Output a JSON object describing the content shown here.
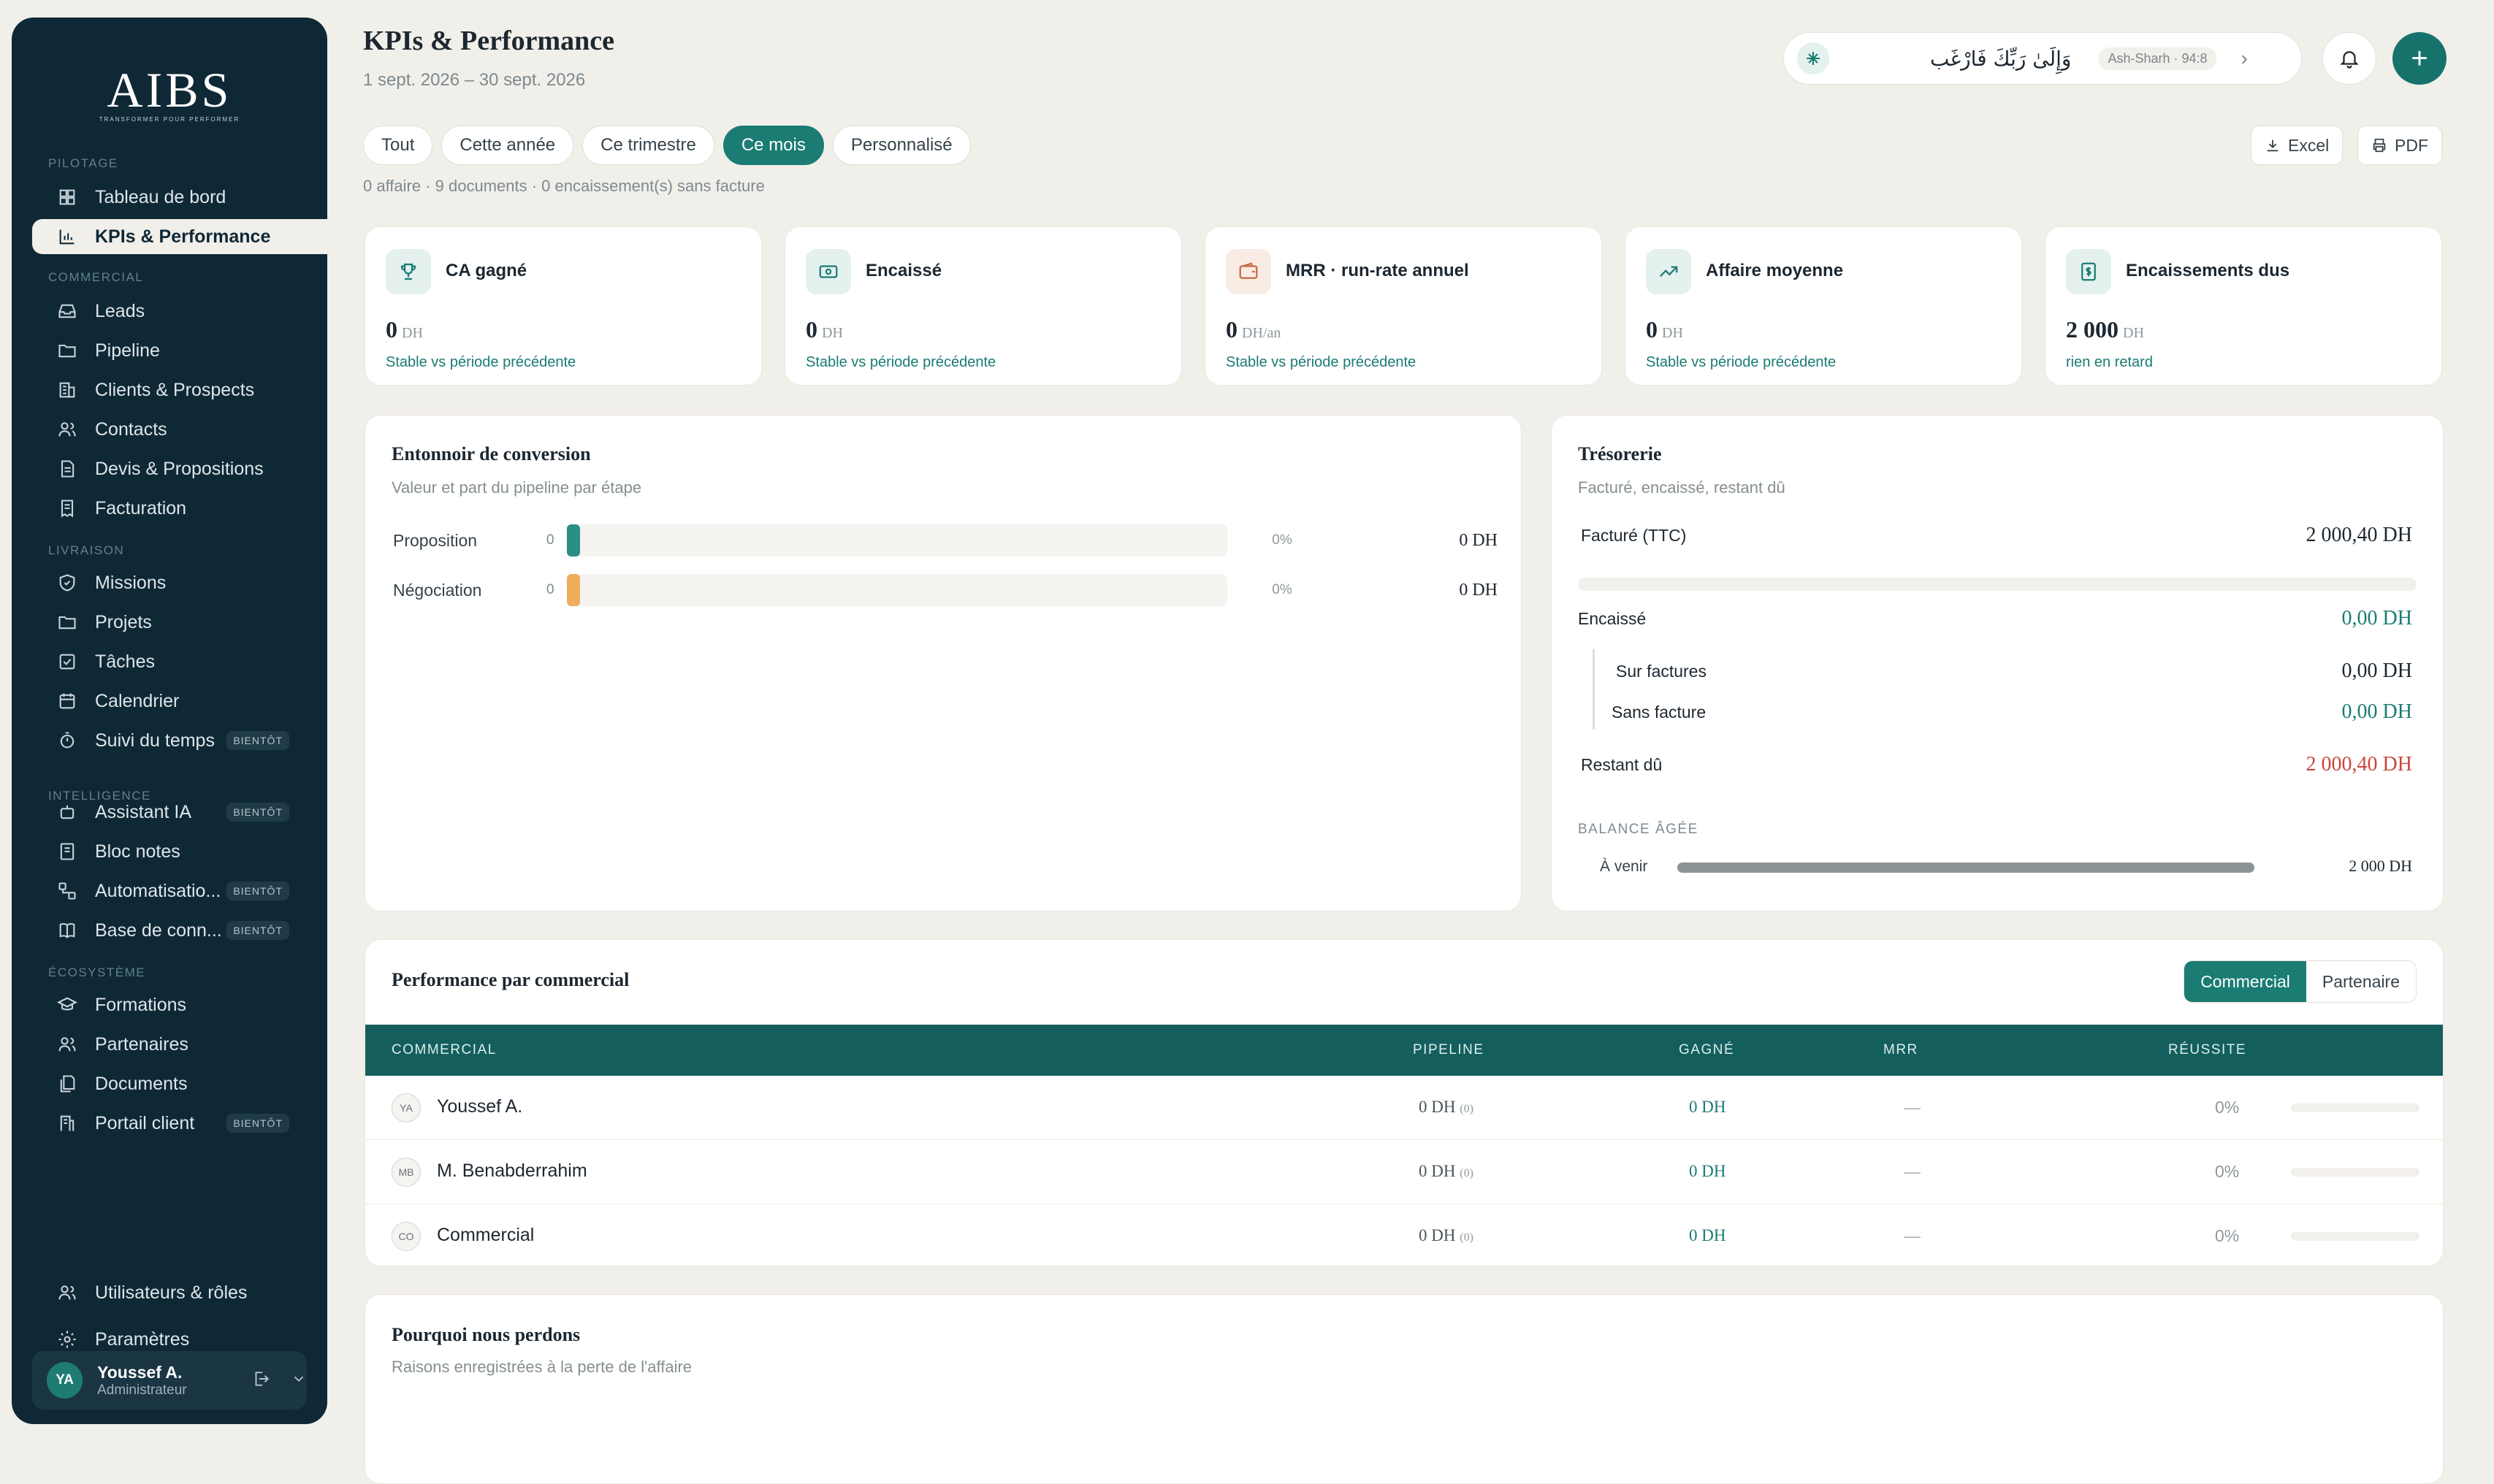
{
  "brand": {
    "name": "AIBS",
    "tagline": "TRANSFORMER POUR PERFORMER"
  },
  "sidebar": {
    "sections": [
      {
        "label": "PILOTAGE"
      },
      {
        "label": "COMMERCIAL"
      },
      {
        "label": "LIVRAISON"
      },
      {
        "label": "INTELLIGENCE"
      },
      {
        "label": "ÉCOSYSTÈME"
      }
    ],
    "items": [
      {
        "label": "Tableau de bord",
        "icon": "grid-icon"
      },
      {
        "label": "KPIs & Performance",
        "icon": "bar-chart-icon",
        "active": true
      },
      {
        "label": "Leads",
        "icon": "inbox-icon"
      },
      {
        "label": "Pipeline",
        "icon": "folder-icon"
      },
      {
        "label": "Clients & Prospects",
        "icon": "building-icon"
      },
      {
        "label": "Contacts",
        "icon": "users-icon"
      },
      {
        "label": "Devis & Propositions",
        "icon": "file-icon"
      },
      {
        "label": "Facturation",
        "icon": "receipt-icon"
      },
      {
        "label": "Missions",
        "icon": "badge-icon"
      },
      {
        "label": "Projets",
        "icon": "folder-icon"
      },
      {
        "label": "Tâches",
        "icon": "checkbox-icon"
      },
      {
        "label": "Calendrier",
        "icon": "calendar-icon"
      },
      {
        "label": "Suivi du temps",
        "icon": "timer-icon",
        "badge": "BIENTÔT"
      },
      {
        "label": "Assistant IA",
        "icon": "bot-icon",
        "badge": "BIENTÔT"
      },
      {
        "label": "Bloc notes",
        "icon": "notebook-icon"
      },
      {
        "label": "Automatisatio...",
        "icon": "workflow-icon",
        "badge": "BIENTÔT"
      },
      {
        "label": "Base de conn...",
        "icon": "book-icon",
        "badge": "BIENTÔT"
      },
      {
        "label": "Formations",
        "icon": "graduation-icon"
      },
      {
        "label": "Partenaires",
        "icon": "users-icon"
      },
      {
        "label": "Documents",
        "icon": "documents-icon"
      },
      {
        "label": "Portail client",
        "icon": "portal-icon",
        "badge": "BIENTÔT"
      }
    ],
    "bottom": [
      {
        "label": "Utilisateurs & rôles",
        "icon": "users-icon"
      },
      {
        "label": "Paramètres",
        "icon": "gear-icon"
      }
    ],
    "user": {
      "initials": "YA",
      "name": "Youssef A.",
      "role": "Administrateur"
    }
  },
  "header": {
    "title": "KPIs & Performance",
    "date_range": "1 sept. 2026 – 30 sept. 2026",
    "verse": {
      "text": "وَإِلَىٰ رَبِّكَ فَارْغَب",
      "ref": "Ash-Sharh · 94:8"
    }
  },
  "filters": [
    "Tout",
    "Cette année",
    "Ce trimestre",
    "Ce mois",
    "Personnalisé"
  ],
  "active_filter": "Ce mois",
  "export": {
    "excel": "Excel",
    "pdf": "PDF"
  },
  "meta": "0 affaire · 9 documents · 0 encaissement(s) sans facture",
  "kpis": [
    {
      "title": "CA gagné",
      "value": "0",
      "unit": "DH",
      "sub": "Stable vs période précédente",
      "icon": "trophy-icon",
      "bg": "#e4f1ee",
      "fg": "#1a7c73"
    },
    {
      "title": "Encaissé",
      "value": "0",
      "unit": "DH",
      "sub": "Stable vs période précédente",
      "icon": "cash-icon",
      "bg": "#e4f1ee",
      "fg": "#1a7c73"
    },
    {
      "title": "MRR · run-rate annuel",
      "value": "0",
      "unit": "DH/an",
      "sub": "Stable vs période précédente",
      "icon": "wallet-icon",
      "bg": "#f8ece4",
      "fg": "#c66a45"
    },
    {
      "title": "Affaire moyenne",
      "value": "0",
      "unit": "DH",
      "sub": "Stable vs période précédente",
      "icon": "trend-up-icon",
      "bg": "#e4f1ee",
      "fg": "#1a7c73"
    },
    {
      "title": "Encaissements dus",
      "value": "2 000",
      "unit": "DH",
      "sub": "rien en retard",
      "icon": "dollar-doc-icon",
      "bg": "#e4f1ee",
      "fg": "#1a7c73"
    }
  ],
  "funnel": {
    "title": "Entonnoir de conversion",
    "desc": "Valeur et part du pipeline par étape",
    "rows": [
      {
        "stage": "Proposition",
        "count": "0",
        "pct": "0%",
        "value": "0 DH",
        "color": "#2a8f86"
      },
      {
        "stage": "Négociation",
        "count": "0",
        "pct": "0%",
        "value": "0 DH",
        "color": "#f0ad5c"
      }
    ]
  },
  "treasury": {
    "title": "Trésorerie",
    "desc": "Facturé, encaissé, restant dû",
    "invoiced_label": "Facturé (TTC)",
    "invoiced": "2 000,40 DH",
    "collected_label": "Encaissé",
    "collected": "0,00 DH",
    "on_invoices_label": "Sur factures",
    "on_invoices": "0,00 DH",
    "without_invoice_label": "Sans facture",
    "without_invoice": "0,00 DH",
    "due_label": "Restant dû",
    "due": "2 000,40 DH",
    "aging_label": "BALANCE ÂGÉE",
    "aging_row_label": "À venir",
    "aging_row_value": "2 000 DH"
  },
  "performance": {
    "title": "Performance par commercial",
    "toggle": [
      "Commercial",
      "Partenaire"
    ],
    "columns": [
      "COMMERCIAL",
      "PIPELINE",
      "GAGNÉ",
      "MRR",
      "RÉUSSITE"
    ],
    "rows": [
      {
        "initials": "YA",
        "name": "Youssef A.",
        "pipeline": "0 DH",
        "count": "(0)",
        "won": "0 DH",
        "mrr": "—",
        "rate": "0%"
      },
      {
        "initials": "MB",
        "name": "M. Benabderrahim",
        "pipeline": "0 DH",
        "count": "(0)",
        "won": "0 DH",
        "mrr": "—",
        "rate": "0%"
      },
      {
        "initials": "CO",
        "name": "Commercial",
        "pipeline": "0 DH",
        "count": "(0)",
        "won": "0 DH",
        "mrr": "—",
        "rate": "0%"
      }
    ]
  },
  "losses": {
    "title": "Pourquoi nous perdons",
    "desc": "Raisons enregistrées à la perte de l'affaire"
  }
}
